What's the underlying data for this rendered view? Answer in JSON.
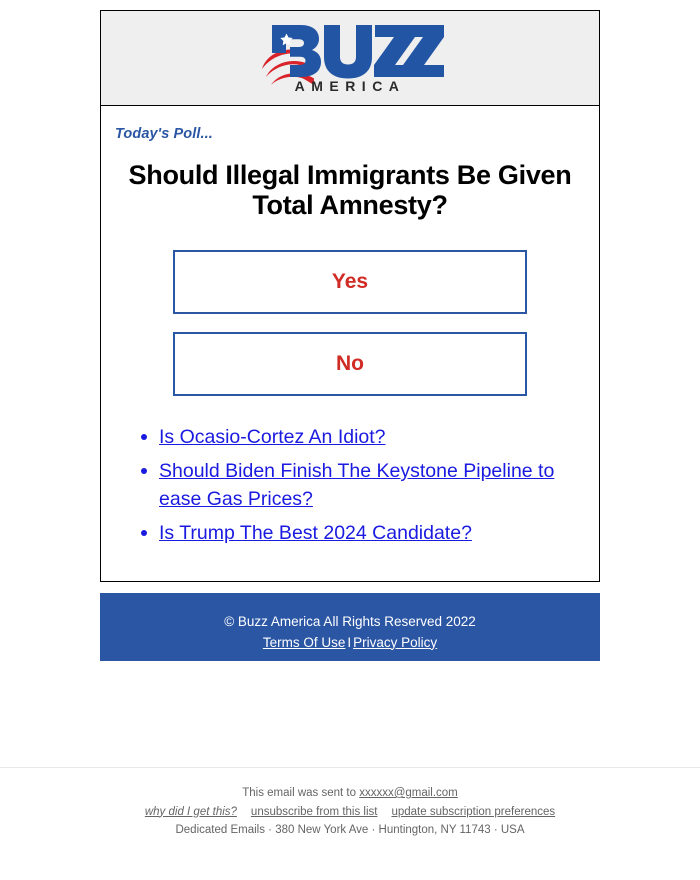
{
  "brand": {
    "logo_word": "BUZZ",
    "logo_sub": "AMERICA",
    "blue": "#2b56a4",
    "red": "#d12b25",
    "link_blue": "#1a1ae0",
    "header_bg": "#efefef"
  },
  "poll": {
    "eyebrow": "Today's Poll...",
    "question": "Should Illegal Immigrants Be Given Total Amnesty?",
    "options": [
      {
        "label": "Yes"
      },
      {
        "label": "No"
      }
    ]
  },
  "links": [
    {
      "label": "Is Ocasio-Cortez An Idiot?"
    },
    {
      "label": "Should Biden Finish The Keystone Pipeline to ease Gas Prices?"
    },
    {
      "label": "Is Trump The Best 2024 Candidate?"
    }
  ],
  "footer": {
    "copyright": "© Buzz America All Rights Reserved 2022",
    "terms_label": "Terms Of Use",
    "separator": "I",
    "privacy_label": "Privacy Policy"
  },
  "mailchimp": {
    "sent_to_prefix": "This email was sent to ",
    "recipient": "xxxxxx@gmail.com",
    "why_label": "why did I get this?",
    "unsubscribe_label": "unsubscribe from this list",
    "update_label": "update subscription preferences",
    "address": "Dedicated Emails · 380 New York Ave · Huntington, NY 11743 · USA"
  }
}
